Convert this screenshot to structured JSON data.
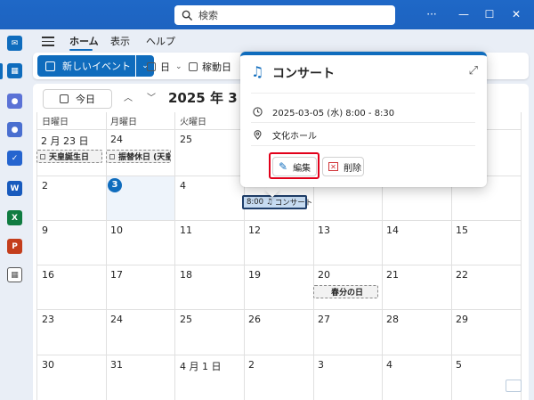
{
  "titlebar": {
    "search_placeholder": "検索",
    "more": "···",
    "minimize": "—",
    "maximize": "☐",
    "close": "✕"
  },
  "ribbon": {
    "tabs": [
      {
        "label": "ホーム",
        "active": true
      },
      {
        "label": "表示"
      },
      {
        "label": "ヘルプ"
      }
    ]
  },
  "commands": {
    "new_event": "新しいイベント",
    "day_view": "日",
    "work_week": "稼動日"
  },
  "calendar": {
    "today_button": "今日",
    "month_title": "2025 年 3 月",
    "weekdays": [
      "日曜日",
      "月曜日",
      "火曜日"
    ],
    "weeks": [
      [
        "2 月 23 日",
        "24",
        "25",
        "",
        "",
        "",
        ""
      ],
      [
        "2",
        "3",
        "4",
        "",
        "",
        "",
        ""
      ],
      [
        "9",
        "10",
        "11",
        "12",
        "13",
        "14",
        "15"
      ],
      [
        "16",
        "17",
        "18",
        "19",
        "20",
        "21",
        "22"
      ],
      [
        "23",
        "24",
        "25",
        "26",
        "27",
        "28",
        "29"
      ],
      [
        "30",
        "31",
        "4 月 1 日",
        "2",
        "3",
        "4",
        "5"
      ]
    ],
    "holidays": {
      "emperor": "天皇誕生日",
      "substitute": "振替休日 (天皇誕",
      "equinox": "春分の日"
    },
    "event_chip": {
      "time": "8:00",
      "title": "コンサート"
    }
  },
  "popup": {
    "title": "コンサート",
    "datetime": "2025-03-05 (水) 8:00 - 8:30",
    "location": "文化ホール",
    "edit": "編集",
    "delete": "削除"
  },
  "colors": {
    "accent": "#0f6cbd",
    "highlight": "#e2001a"
  }
}
